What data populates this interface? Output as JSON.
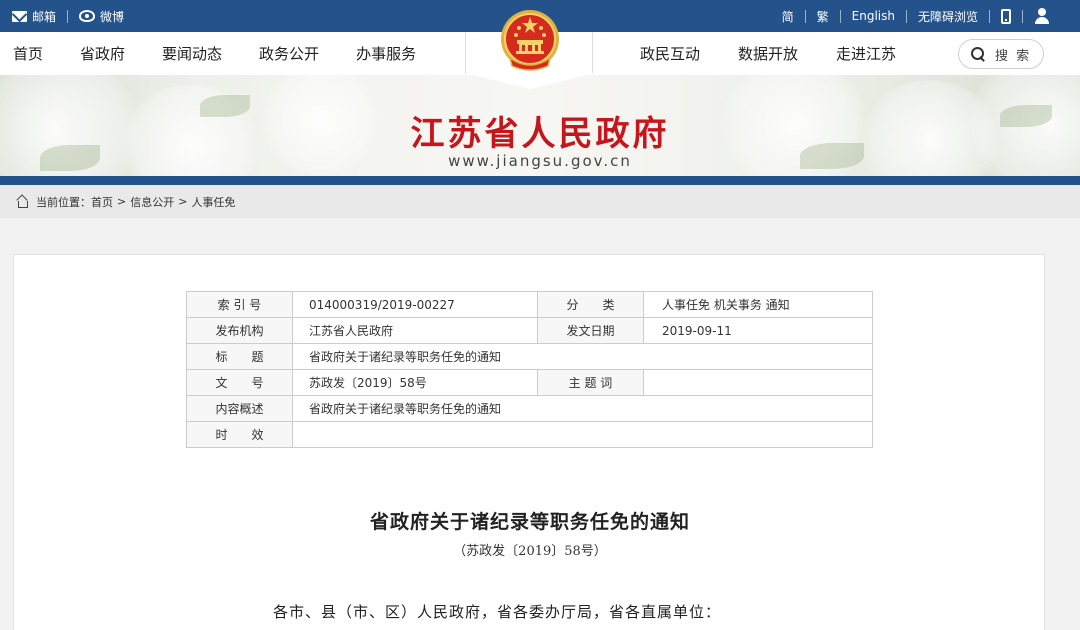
{
  "topbar": {
    "mail": "邮箱",
    "weibo": "微博",
    "simplified": "简",
    "traditional": "繁",
    "english": "English",
    "accessibility": "无障碍浏览"
  },
  "nav": {
    "left": [
      "首页",
      "省政府",
      "要闻动态",
      "政务公开",
      "办事服务"
    ],
    "right": [
      "政民互动",
      "数据开放",
      "走进江苏"
    ],
    "search_label": "搜 索"
  },
  "banner": {
    "title": "江苏省人民政府",
    "url": "www.jiangsu.gov.cn"
  },
  "breadcrumb": {
    "label": "当前位置：",
    "items": [
      "首页",
      "信息公开",
      "人事任免"
    ],
    "sep": ">"
  },
  "meta": {
    "index_no_label": "索 引 号",
    "index_no": "014000319/2019-00227",
    "category_label": "分　　类",
    "category": "人事任免 机关事务 通知",
    "issuer_label": "发布机构",
    "issuer": "江苏省人民政府",
    "date_label": "发文日期",
    "date": "2019-09-11",
    "title_label": "标　　题",
    "title": "省政府关于诸纪录等职务任免的通知",
    "doc_no_label": "文　　号",
    "doc_no": "苏政发〔2019〕58号",
    "keywords_label": "主 题 词",
    "keywords": "",
    "summary_label": "内容概述",
    "summary": "省政府关于诸纪录等职务任免的通知",
    "validity_label": "时　　效",
    "validity": ""
  },
  "document": {
    "title": "省政府关于诸纪录等职务任免的通知",
    "number": "（苏政发〔2019〕58号）",
    "salutation": "各市、县（市、区）人民政府，省各委办厅局，省各直属单位："
  },
  "colors": {
    "topbar": "#24538c",
    "title_red": "#c4161c"
  }
}
